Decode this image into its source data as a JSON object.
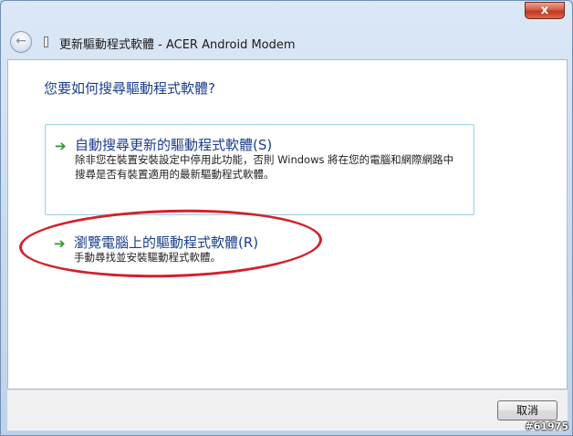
{
  "window": {
    "title": "更新驅動程式軟體 - ACER Android Modem",
    "close_label": "x"
  },
  "nav": {
    "back_icon": "back-arrow-icon"
  },
  "content": {
    "heading": "您要如何搜尋驅動程式軟體?",
    "options": [
      {
        "title": "自動搜尋更新的驅動程式軟體(S)",
        "description_line1": "除非您在裝置安裝設定中停用此功能，否則 Windows 將在您的電腦和網際網路中",
        "description_line2": "搜尋是否有裝置適用的最新驅動程式軟體。",
        "icon": "green-arrow-icon"
      },
      {
        "title": "瀏覽電腦上的驅動程式軟體(R)",
        "description_line1": "手動尋找並安裝驅動程式軟體。",
        "icon": "green-arrow-icon"
      }
    ]
  },
  "footer": {
    "cancel_label": "取消"
  },
  "watermark": "#61975",
  "colors": {
    "link_blue": "#1a3e8c",
    "arrow_green": "#2d9a2d",
    "annotation_red": "#d4202a"
  }
}
